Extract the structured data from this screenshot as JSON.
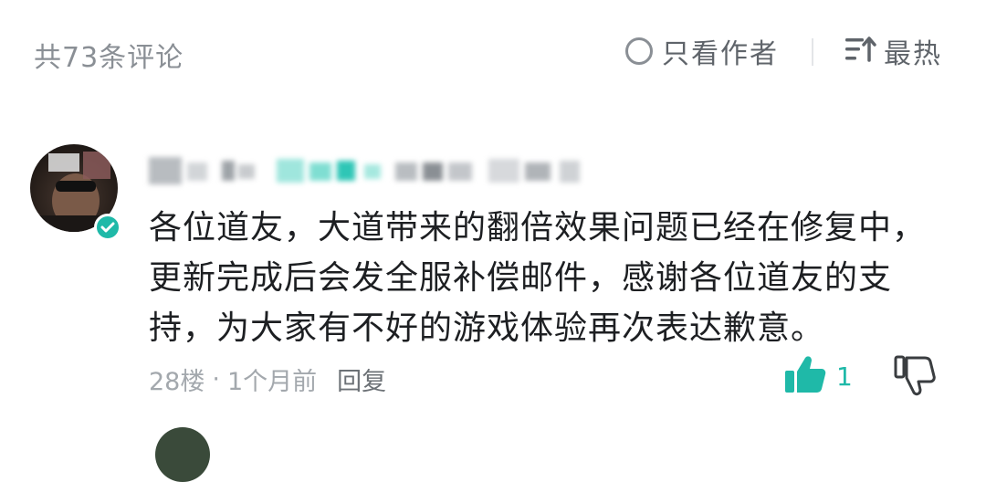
{
  "header": {
    "comment_count_label": "共73条评论",
    "author_only_label": "只看作者",
    "sort_label": "最热"
  },
  "comment": {
    "text": "各位道友，大道带来的翻倍效果问题已经在修复中，更新完成后会发全服补偿邮件，感谢各位道友的支持，为大家有不好的游戏体验再次表达歉意。",
    "floor": "28楼",
    "separator": "·",
    "time": "1个月前",
    "reply_label": "回复",
    "like_count": "1"
  },
  "colors": {
    "accent": "#1fb9a8",
    "muted": "#8a8f95"
  },
  "icons": {
    "author_only": "radio-circle-icon",
    "sort": "sort-lines-icon",
    "verified": "verified-check-icon",
    "like": "thumbs-up-icon",
    "dislike": "thumbs-down-icon"
  }
}
